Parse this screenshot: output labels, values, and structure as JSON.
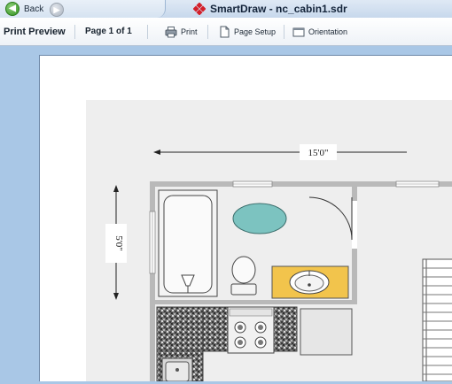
{
  "titlebar": {
    "back_label": "Back",
    "document_title": "SmartDraw - nc_cabin1.sdr"
  },
  "toolbar": {
    "title": "Print Preview",
    "page_indicator": "Page 1 of 1",
    "print_label": "Print",
    "page_setup_label": "Page Setup",
    "orientation_label": "Orientation"
  },
  "floorplan": {
    "width_dimension": "15'0\"",
    "height_dimension": "5'0\""
  },
  "icons": {
    "back": "back-arrow-icon",
    "forward": "forward-arrow-icon",
    "logo": "smartdraw-diamond-icon",
    "print": "printer-icon",
    "page_setup": "page-icon",
    "orientation": "orientation-icon"
  },
  "colors": {
    "chrome_blue": "#a9c7e6",
    "tub_water": "#7cc3c0",
    "vanity_top": "#f2c44c",
    "wall": "#b9b9b9",
    "counter_granite": "#6e6e6e"
  }
}
